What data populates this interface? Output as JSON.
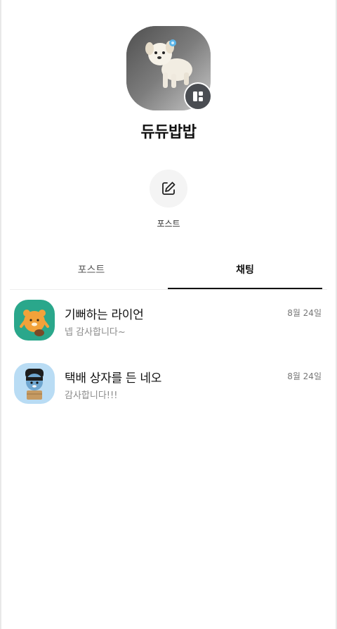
{
  "profile": {
    "name": "듀듀밥밥",
    "avatar_icon": "puppy-photo",
    "badge_icon": "profile-card-icon"
  },
  "actions": [
    {
      "label": "포스트",
      "icon": "edit-icon"
    }
  ],
  "tabs": [
    {
      "label": "포스트",
      "selected": false
    },
    {
      "label": "채팅",
      "selected": true
    }
  ],
  "chats": [
    {
      "name": "기뻐하는 라이언",
      "preview": "넵 감사합니다~",
      "date": "8월 24일",
      "avatar_icon": "ryan-character"
    },
    {
      "name": "택배 상자를 든 네오",
      "preview": "감사합니다!!!",
      "date": "8월 24일",
      "avatar_icon": "neo-character"
    }
  ],
  "colors": {
    "active_tab_underline": "#111111",
    "badge_bg": "#4a4d52",
    "ryan_bg": "#2aa78b",
    "neo_bg": "#b9dcf4"
  }
}
